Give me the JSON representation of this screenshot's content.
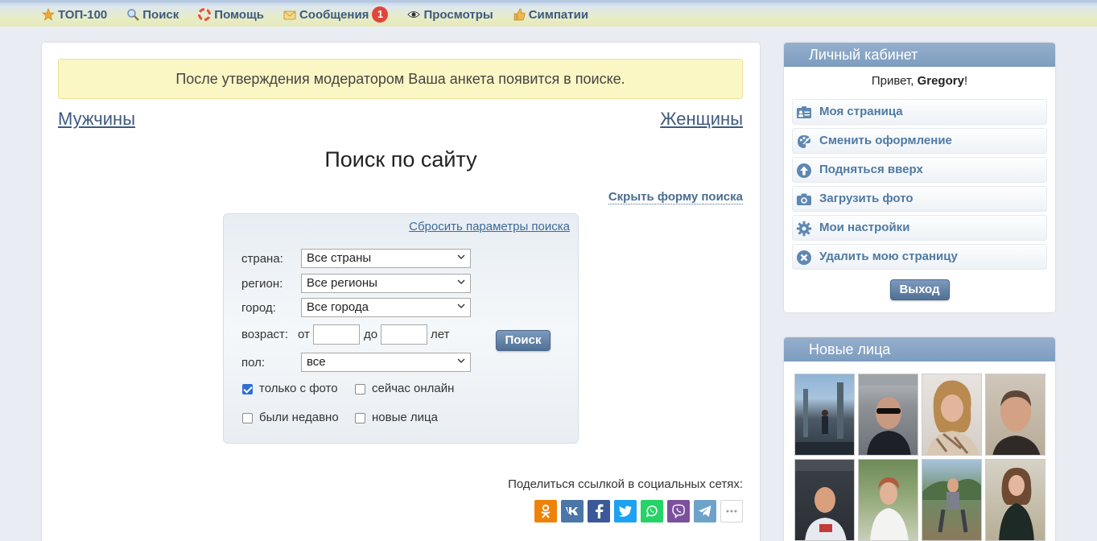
{
  "nav": {
    "items": [
      {
        "label": "ТОП-100",
        "icon": "star-icon"
      },
      {
        "label": "Поиск",
        "icon": "magnifier-icon"
      },
      {
        "label": "Помощь",
        "icon": "lifebuoy-icon"
      },
      {
        "label": "Сообщения",
        "icon": "envelope-icon",
        "badge": "1"
      },
      {
        "label": "Просмотры",
        "icon": "eye-icon"
      },
      {
        "label": "Симпатии",
        "icon": "thumbs-up-icon"
      }
    ]
  },
  "main": {
    "notice": "После утверждения модератором Ваша анкета появится в поиске.",
    "men_link": "Мужчины",
    "women_link": "Женщины",
    "title": "Поиск по сайту",
    "hide_form_link": "Скрыть форму поиска",
    "search": {
      "reset_link": "Сбросить параметры поиска",
      "country_label": "страна:",
      "country_value": "Все страны",
      "region_label": "регион:",
      "region_value": "Все регионы",
      "city_label": "город:",
      "city_value": "Все города",
      "age_label": "возраст:",
      "age_from": "от",
      "age_to": "до",
      "age_unit": "лет",
      "gender_label": "пол:",
      "gender_value": "все",
      "search_button": "Поиск",
      "checkboxes": [
        {
          "label": "только с фото",
          "checked": true
        },
        {
          "label": "сейчас онлайн",
          "checked": false
        },
        {
          "label": "были недавно",
          "checked": false
        },
        {
          "label": "новые лица",
          "checked": false
        }
      ]
    },
    "share_text": "Поделиться ссылкой в социальных сетях:",
    "share_buttons": [
      {
        "name": "odnoklassniki-icon",
        "color": "#ee8208"
      },
      {
        "name": "vk-icon",
        "color": "#4a76a8"
      },
      {
        "name": "facebook-icon",
        "color": "#3b5998"
      },
      {
        "name": "twitter-icon",
        "color": "#1da1f2"
      },
      {
        "name": "whatsapp-icon",
        "color": "#25d366"
      },
      {
        "name": "viber-icon",
        "color": "#7b519d"
      },
      {
        "name": "telegram-icon",
        "color": "#6ea3c9"
      },
      {
        "name": "more-icon",
        "color": "#ffffff"
      }
    ]
  },
  "cabinet": {
    "title": "Личный кабинет",
    "greeting_prefix": "Привет, ",
    "username": "Gregory",
    "greeting_suffix": "!",
    "menu": [
      {
        "label": "Моя страница",
        "icon": "id-card-icon"
      },
      {
        "label": "Сменить оформление",
        "icon": "palette-icon"
      },
      {
        "label": "Подняться вверх",
        "icon": "arrow-up-icon"
      },
      {
        "label": "Загрузить фото",
        "icon": "camera-icon"
      },
      {
        "label": "Мои настройки",
        "icon": "gear-icon"
      },
      {
        "label": "Удалить мою страницу",
        "icon": "close-icon"
      }
    ],
    "logout": "Выход"
  },
  "new_faces": {
    "title": "Новые лица"
  }
}
